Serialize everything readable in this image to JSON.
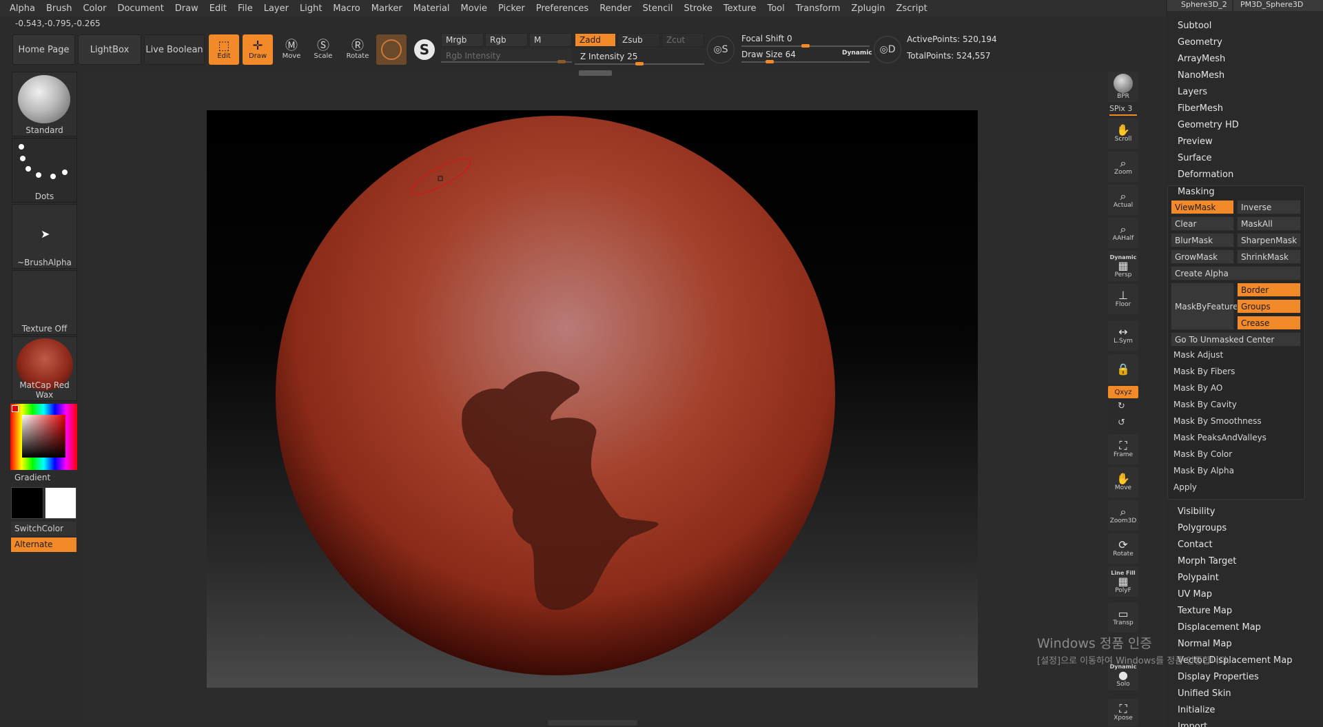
{
  "menu": [
    "Alpha",
    "Brush",
    "Color",
    "Document",
    "Draw",
    "Edit",
    "File",
    "Layer",
    "Light",
    "Macro",
    "Marker",
    "Material",
    "Movie",
    "Picker",
    "Preferences",
    "Render",
    "Stencil",
    "Stroke",
    "Texture",
    "Tool",
    "Transform",
    "Zplugin",
    "Zscript"
  ],
  "coords": "-0.543,-0.795,-0.265",
  "toolbar": {
    "home_page": "Home Page",
    "lightbox": "LightBox",
    "live_boolean": "Live Boolean",
    "edit": "Edit",
    "draw": "Draw",
    "move": "Move",
    "scale": "Scale",
    "rotate": "Rotate",
    "mrgb": "Mrgb",
    "rgb": "Rgb",
    "m": "M",
    "rgb_intensity": "Rgb Intensity",
    "zadd": "Zadd",
    "zsub": "Zsub",
    "zcut": "Zcut",
    "z_intensity": "Z Intensity 25",
    "focal_shift": "Focal Shift 0",
    "draw_size": "Draw Size 64",
    "dynamic": "Dynamic",
    "active_points": "ActivePoints: 520,194",
    "total_points": "TotalPoints: 524,557",
    "sliders": {
      "rgb_intensity": 0.95,
      "z_intensity": 0.5,
      "focal_shift": 0.5,
      "draw_size": 0.2
    }
  },
  "shelf": {
    "standard": "Standard",
    "dots": "Dots",
    "brush_alpha": "~BrushAlpha",
    "texture_off": "Texture Off",
    "matcap": "MatCap Red Wax",
    "gradient": "Gradient",
    "switch_color": "SwitchColor",
    "alternate": "Alternate"
  },
  "right_tools": {
    "bpr": "BPR",
    "spix": "SPix 3",
    "scroll": "Scroll",
    "zoom": "Zoom",
    "actual": "Actual",
    "aahalf": "AAHalf",
    "dynamic": "Dynamic",
    "persp": "Persp",
    "floor": "Floor",
    "lsym": "L.Sym",
    "xyz": "Qxyz",
    "frame": "Frame",
    "move": "Move",
    "zoom3d": "Zoom3D",
    "rotate": "Rotate",
    "line_fill": "Line Fill",
    "polyf": "PolyF",
    "transp": "Transp",
    "dynamic2": "Dynamic",
    "solo": "Solo",
    "xpose": "Xpose"
  },
  "palette": {
    "subtool_tabs": [
      "Sphere3D_2",
      "PM3D_Sphere3D"
    ],
    "sections_top": [
      "Subtool",
      "Geometry",
      "ArrayMesh",
      "NanoMesh",
      "Layers",
      "FiberMesh",
      "Geometry HD",
      "Preview",
      "Surface",
      "Deformation"
    ],
    "masking_title": "Masking",
    "masking_buttons": {
      "viewmask": "ViewMask",
      "inverse": "Inverse",
      "clear": "Clear",
      "maskall": "MaskAll",
      "blurmask": "BlurMask",
      "sharpenmask": "SharpenMask",
      "growmask": "GrowMask",
      "shrinkmask": "ShrinkMask",
      "create_alpha": "Create Alpha",
      "maskbyfeature": "MaskByFeature",
      "border": "Border",
      "groups": "Groups",
      "crease": "Crease",
      "go_to_unmasked": "Go To Unmasked Center"
    },
    "masking_list": [
      "Mask Adjust",
      "Mask By Fibers",
      "Mask By AO",
      "Mask By Cavity",
      "Mask By Smoothness",
      "Mask PeaksAndValleys",
      "Mask By Color",
      "Mask By Alpha",
      "Apply"
    ],
    "sections_bottom": [
      "Visibility",
      "Polygroups",
      "Contact",
      "Morph Target",
      "Polypaint",
      "UV Map",
      "Texture Map",
      "Displacement Map",
      "Normal Map",
      "Vector Displacement Map",
      "Display Properties",
      "Unified Skin",
      "Initialize",
      "Import"
    ]
  },
  "watermark": {
    "line1": "Windows 정품 인증",
    "line2": "[설정]으로 이동하여 Windows를 정품 인증합니다."
  },
  "colors": {
    "accent": "#f28a2a",
    "sphere": "#a8381f",
    "mask": "#4a1a10"
  }
}
